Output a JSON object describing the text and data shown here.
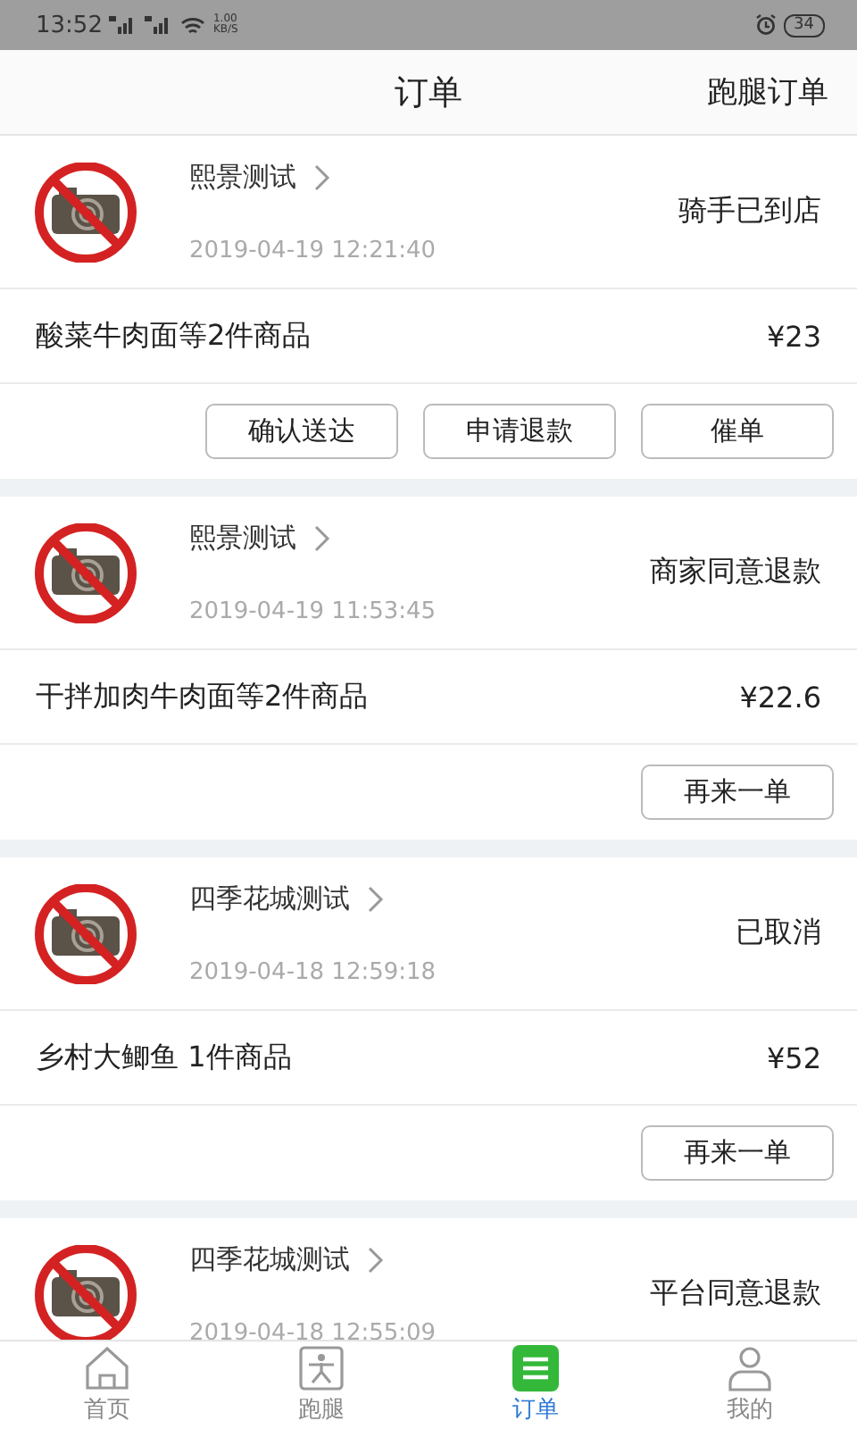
{
  "status_bar": {
    "time": "13:52",
    "speed": "1.00",
    "speed_unit": "KB/S",
    "battery": "34"
  },
  "header": {
    "title": "订单",
    "action": "跑腿订单"
  },
  "orders": [
    {
      "shop": "熙景测试",
      "time": "2019-04-19 12:21:40",
      "status": "骑手已到店",
      "items": "酸菜牛肉面等2件商品",
      "price": "¥23",
      "buttons": [
        "确认送达",
        "申请退款",
        "催单"
      ]
    },
    {
      "shop": "熙景测试",
      "time": "2019-04-19 11:53:45",
      "status": "商家同意退款",
      "items": "干拌加肉牛肉面等2件商品",
      "price": "¥22.6",
      "buttons": [
        "再来一单"
      ]
    },
    {
      "shop": "四季花城测试",
      "time": "2019-04-18 12:59:18",
      "status": "已取消",
      "items": "乡村大鲫鱼 1件商品",
      "price": "¥52",
      "buttons": [
        "再来一单"
      ]
    },
    {
      "shop": "四季花城测试",
      "time": "2019-04-18 12:55:09",
      "status": "平台同意退款"
    }
  ],
  "nav": [
    {
      "kind": "home",
      "label": "首页",
      "selected": false
    },
    {
      "kind": "errand",
      "label": "跑腿",
      "selected": false
    },
    {
      "kind": "orders",
      "label": "订单",
      "selected": true
    },
    {
      "kind": "profile",
      "label": "我的",
      "selected": false
    }
  ]
}
